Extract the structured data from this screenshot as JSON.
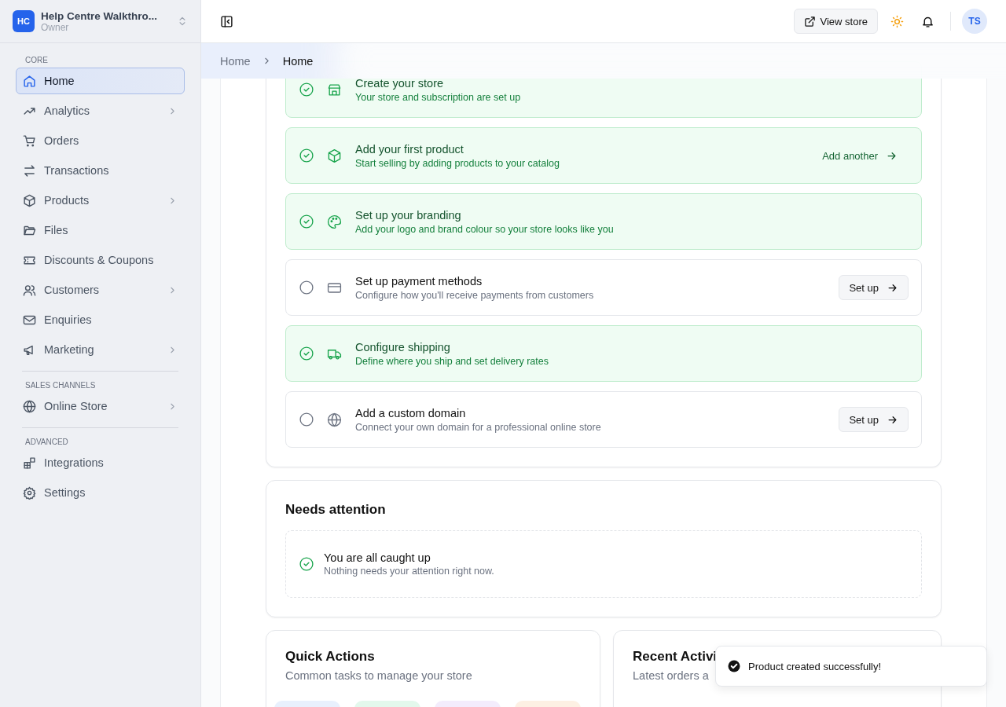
{
  "workspace": {
    "initials": "HC",
    "name": "Help Centre Walkthro...",
    "role": "Owner"
  },
  "sidebar": {
    "sections": [
      {
        "heading": "CORE",
        "items": [
          {
            "label": "Home",
            "selected": true,
            "expandable": false
          },
          {
            "label": "Analytics",
            "selected": false,
            "expandable": true
          },
          {
            "label": "Orders",
            "selected": false,
            "expandable": false
          },
          {
            "label": "Transactions",
            "selected": false,
            "expandable": false
          },
          {
            "label": "Products",
            "selected": false,
            "expandable": true
          },
          {
            "label": "Files",
            "selected": false,
            "expandable": false
          },
          {
            "label": "Discounts & Coupons",
            "selected": false,
            "expandable": false
          },
          {
            "label": "Customers",
            "selected": false,
            "expandable": true
          },
          {
            "label": "Enquiries",
            "selected": false,
            "expandable": false
          },
          {
            "label": "Marketing",
            "selected": false,
            "expandable": true
          }
        ]
      },
      {
        "heading": "SALES CHANNELS",
        "items": [
          {
            "label": "Online Store",
            "selected": false,
            "expandable": true
          }
        ]
      },
      {
        "heading": "ADVANCED",
        "items": [
          {
            "label": "Integrations",
            "selected": false,
            "expandable": false
          },
          {
            "label": "Settings",
            "selected": false,
            "expandable": false
          }
        ]
      }
    ]
  },
  "topbar": {
    "view_store": "View store",
    "avatar": "TS"
  },
  "breadcrumb": [
    "Home",
    "Home"
  ],
  "steps": [
    {
      "title": "Create your store",
      "description": "Your store and subscription are set up",
      "done": true
    },
    {
      "title": "Add your first product",
      "description": "Start selling by adding products to your catalog",
      "done": true,
      "action": {
        "kind": "link",
        "label": "Add another"
      }
    },
    {
      "title": "Set up your branding",
      "description": "Add your logo and brand colour so your store looks like you",
      "done": true
    },
    {
      "title": "Set up payment methods",
      "description": "Configure how you'll receive payments from customers",
      "done": false,
      "action": {
        "kind": "button",
        "label": "Set up"
      }
    },
    {
      "title": "Configure shipping",
      "description": "Define where you ship and set delivery rates",
      "done": true
    },
    {
      "title": "Add a custom domain",
      "description": "Connect your own domain for a professional online store",
      "done": false,
      "action": {
        "kind": "button",
        "label": "Set up"
      }
    }
  ],
  "needs_attention": {
    "title": "Needs attention",
    "message": "You are all caught up",
    "detail": "Nothing needs your attention right now."
  },
  "quick_actions": {
    "title": "Quick Actions",
    "subtitle": "Common tasks to manage your store",
    "tiles": [
      {
        "color": "#e8f0fd"
      },
      {
        "color": "#e3f8ec"
      },
      {
        "color": "#f3ecfc"
      },
      {
        "color": "#fdf0e3"
      }
    ]
  },
  "recent_activity": {
    "title": "Recent Activi",
    "subtitle": "Latest orders a"
  },
  "toast": {
    "message": "Product created successfully!"
  }
}
